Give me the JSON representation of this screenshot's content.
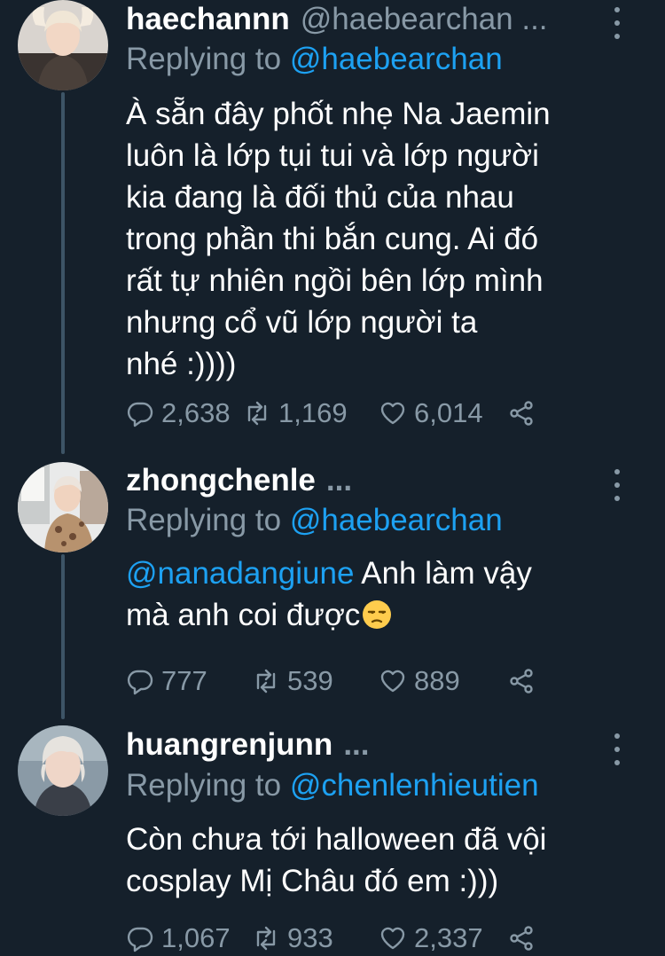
{
  "colors": {
    "background": "#15202b",
    "text_primary": "#ffffff",
    "text_secondary": "#8899a6",
    "link": "#1da1f2",
    "thread_line": "#3d5466"
  },
  "tweets": [
    {
      "display_name": "haechannn",
      "handle": "@haebearchan ...",
      "replying_prefix": "Replying to ",
      "replying_to": "@haebearchan",
      "lines": [
        "À sẵn đây phốt nhẹ Na Jaemin",
        "luôn là lớp tụi tui và lớp người",
        "kia đang là đối thủ của nhau",
        "trong phần thi bắn cung. Ai đó",
        "rất tự nhiên ngồi bên lớp mình",
        "nhưng cổ vũ lớp người ta",
        "nhé :))))"
      ],
      "replies": "2,638",
      "retweets": "1,169",
      "likes": "6,014",
      "avatar": "avatar-photo"
    },
    {
      "display_name": "zhongchenle",
      "ellipsis": "...",
      "replying_prefix": "Replying to ",
      "replying_to": "@haebearchan",
      "mention": "@nanadangiune",
      "line1_rest": " Anh làm vậy",
      "line2": "mà anh coi được",
      "emoji": "unamused-face-emoji",
      "replies": "777",
      "retweets": "539",
      "likes": "889",
      "avatar": "avatar-photo"
    },
    {
      "display_name": "huangrenjunn",
      "ellipsis": "...",
      "replying_prefix": "Replying to ",
      "replying_to": "@chenlenhieutien",
      "lines": [
        "Còn chưa tới halloween đã vội",
        "cosplay Mị Châu đó em :)))"
      ],
      "replies": "1,067",
      "retweets": "933",
      "likes": "2,337",
      "avatar": "avatar-photo"
    }
  ],
  "icons": {
    "reply": "reply-icon",
    "retweet": "retweet-icon",
    "like": "heart-icon",
    "share": "share-icon",
    "more": "more-vertical-icon"
  }
}
